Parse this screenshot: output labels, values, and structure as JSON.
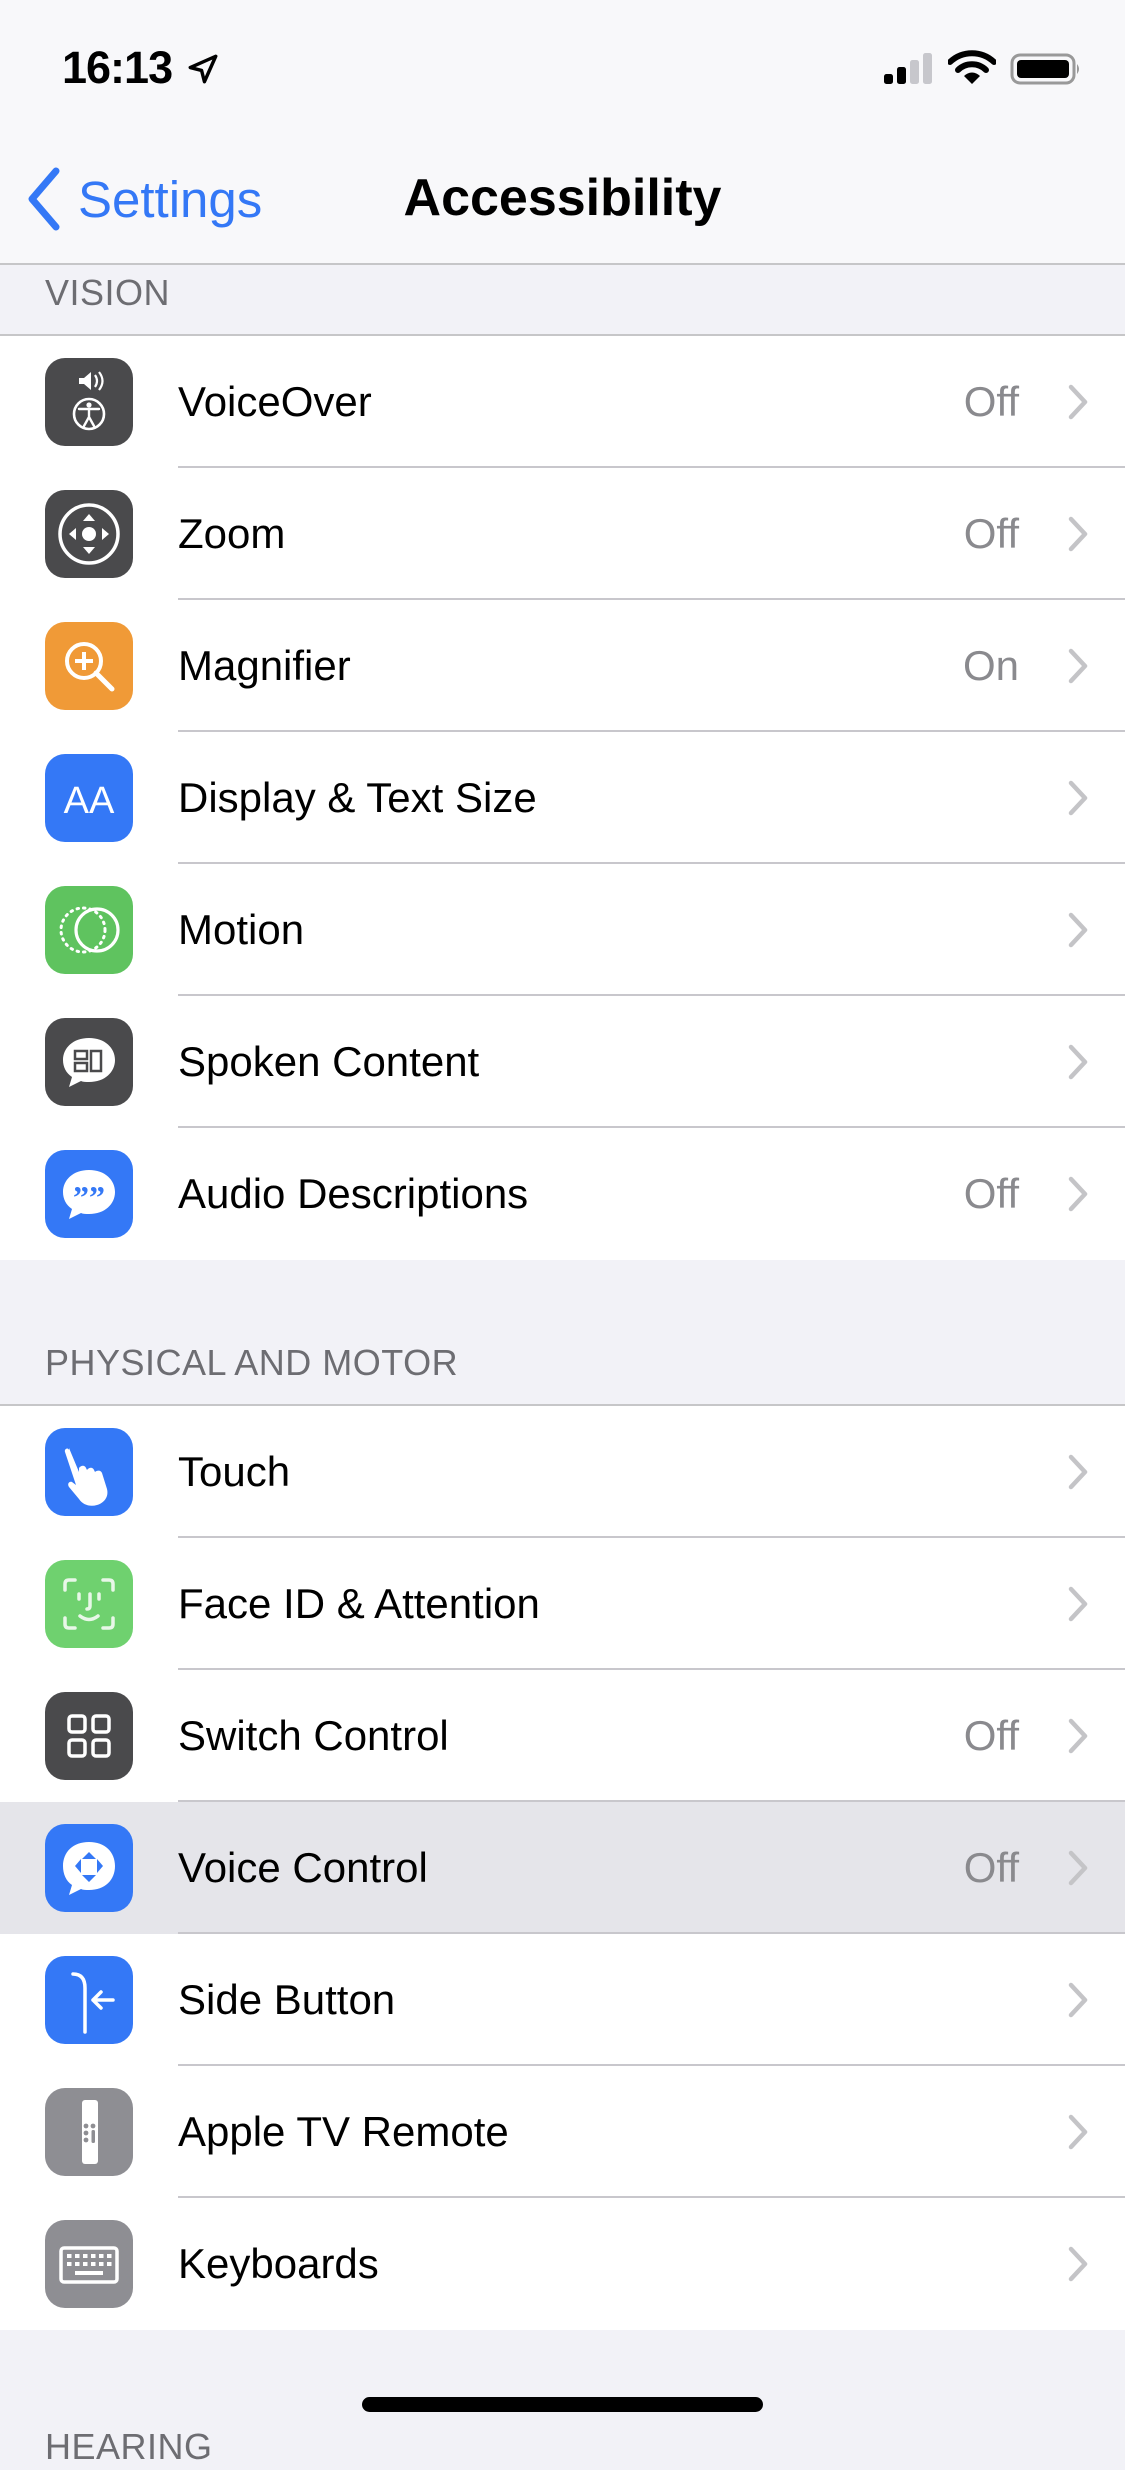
{
  "status_bar": {
    "time": "16:13",
    "location_icon": "location-arrow-icon",
    "signal_bars": 2,
    "signal_bars_total": 4,
    "wifi_icon": "wifi-icon",
    "battery_icon": "battery-icon",
    "battery_level": 1.0
  },
  "nav": {
    "back_label": "Settings",
    "title": "Accessibility"
  },
  "colors": {
    "accent": "#3478f6",
    "highlight_row": "#e5e5ea",
    "grouped_background": "#f2f2f7",
    "secondary_text": "#8a8a8e"
  },
  "sections": [
    {
      "header": "VISION",
      "rows": [
        {
          "label": "VoiceOver",
          "value": "Off",
          "icon": "voiceover-icon",
          "icon_color": "#4a4a4c"
        },
        {
          "label": "Zoom",
          "value": "Off",
          "icon": "zoom-icon",
          "icon_color": "#4a4a4c"
        },
        {
          "label": "Magnifier",
          "value": "On",
          "icon": "magnifier-icon",
          "icon_color": "#f09a37"
        },
        {
          "label": "Display & Text Size",
          "value": "",
          "icon": "text-size-icon",
          "icon_color": "#3478f6"
        },
        {
          "label": "Motion",
          "value": "",
          "icon": "motion-icon",
          "icon_color": "#5fc35f"
        },
        {
          "label": "Spoken Content",
          "value": "",
          "icon": "spoken-content-icon",
          "icon_color": "#4a4a4c"
        },
        {
          "label": "Audio Descriptions",
          "value": "Off",
          "icon": "audio-descriptions-icon",
          "icon_color": "#3478f6"
        }
      ]
    },
    {
      "header": "PHYSICAL AND MOTOR",
      "rows": [
        {
          "label": "Touch",
          "value": "",
          "icon": "touch-hand-icon",
          "icon_color": "#3478f6"
        },
        {
          "label": "Face ID & Attention",
          "value": "",
          "icon": "face-id-icon",
          "icon_color": "#6fd16f"
        },
        {
          "label": "Switch Control",
          "value": "Off",
          "icon": "switch-control-icon",
          "icon_color": "#4a4a4c"
        },
        {
          "label": "Voice Control",
          "value": "Off",
          "icon": "voice-control-icon",
          "icon_color": "#3478f6",
          "highlighted": true
        },
        {
          "label": "Side Button",
          "value": "",
          "icon": "side-button-icon",
          "icon_color": "#3478f6"
        },
        {
          "label": "Apple TV Remote",
          "value": "",
          "icon": "apple-tv-remote-icon",
          "icon_color": "#8e8e93"
        },
        {
          "label": "Keyboards",
          "value": "",
          "icon": "keyboard-icon",
          "icon_color": "#8e8e93"
        }
      ]
    },
    {
      "header": "HEARING",
      "rows": []
    }
  ]
}
